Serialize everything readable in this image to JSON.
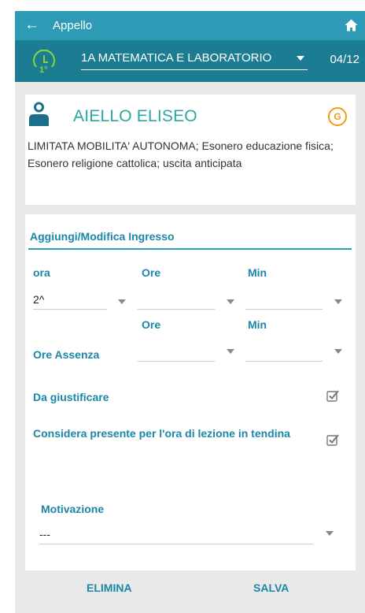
{
  "header": {
    "back_icon": "back-arrow-icon",
    "title": "Appello",
    "home_icon": "home-icon"
  },
  "subheader": {
    "clock_icon": "clock-icon",
    "clock_text": "1°",
    "class_selected": "1A MATEMATICA E LABORATORIO",
    "date": "04/12"
  },
  "student": {
    "name": "AIELLO ELISEO",
    "badge": "G",
    "notes": "LIMITATA MOBILITA' AUTONOMA; Esonero educazione fisica; Esonero religione cattolica; uscita anticipata"
  },
  "form": {
    "title": "Aggiungi/Modifica Ingresso",
    "ora_label": "ora",
    "ora_value": "2^",
    "ore_label": "Ore",
    "min_label": "Min",
    "ore_label_2": "Ore",
    "min_label_2": "Min",
    "ore_assenza_label": "Ore Assenza",
    "da_giustificare_label": "Da giustificare",
    "da_giustificare_checked": true,
    "considera_label": "Considera presente per l'ora di lezione in tendina",
    "considera_checked": true,
    "motivazione_label": "Motivazione",
    "motivazione_value": "---"
  },
  "actions": {
    "elimina": "ELIMINA",
    "salva": "SALVA"
  },
  "colors": {
    "header": "#2d9bb5",
    "subheader": "#1c7d92",
    "label": "#1a87a8",
    "student_name": "#2aa7a0",
    "badge": "#f39c12",
    "clock": "#8dd23f"
  }
}
